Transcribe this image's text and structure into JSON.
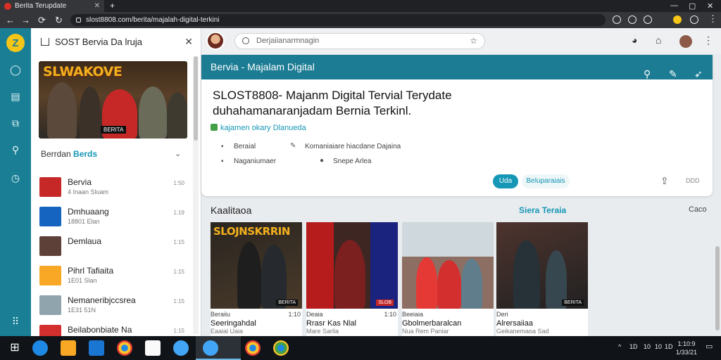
{
  "browser": {
    "tab_title": "Berita Terupdate",
    "new_tab_glyph": "+",
    "url": "slost8808.com/berita/majalah-digital-terkini",
    "window_controls": [
      "—",
      "▢",
      "✕"
    ]
  },
  "rail": {
    "logo_glyph": "Z",
    "icons": [
      "chat-icon",
      "save-icon",
      "book-icon",
      "search-icon",
      "clock-icon",
      "apps-icon"
    ]
  },
  "sidebar": {
    "title": "SOST Bervia Da lruja",
    "hero_title": "SLWAKOVE",
    "hero_caption": "BERITA",
    "section_prefix": "Berrdan",
    "section_accent": "Berds",
    "items": [
      {
        "title": "Bervia",
        "sub": "4 Inaan Sluam",
        "meta": "1:50",
        "color": "#c62828"
      },
      {
        "title": "Dmhuaang",
        "sub": "18801 Elan",
        "meta": "1:19",
        "color": "#1565c0"
      },
      {
        "title": "Demlaua",
        "sub": "",
        "meta": "1:15",
        "color": "#5d4037"
      },
      {
        "title": "Pihrl Tafiaita",
        "sub": "1E01 Slan",
        "meta": "1:15",
        "color": "#f9a825"
      },
      {
        "title": "Nemaneribjccsrea",
        "sub": "1E31 51N",
        "meta": "1:15",
        "color": "#90a4ae"
      },
      {
        "title": "Beilabonbiate Na",
        "sub": "",
        "meta": "1:15",
        "color": "#d32f2f"
      }
    ]
  },
  "main": {
    "search_placeholder": "Derjaiianarmnagin",
    "card_bar_title": "Bervia - Majalam Digital",
    "headline_1": "SLOST8808- Majanm Digital Tervial Terydate",
    "headline_2": "duhahamanaranjadam Bernia Terkinl.",
    "source": "kajamen okary Dlanueda",
    "meta": [
      {
        "icon": "tag-icon",
        "label": "Beraial"
      },
      {
        "icon": "pin-icon",
        "label": "Komaniaiare hiacdane Dajaina"
      },
      {
        "icon": "doc-icon",
        "label": "Naganiumaer"
      },
      {
        "icon": "user-icon",
        "label": "Snepe Arlea"
      }
    ],
    "pill_label": "Uda",
    "secondary_label": "Beluparaiais",
    "more_label": "DDD",
    "grid_title": "Kaalitaoa",
    "grid_link": "Siera Teraia",
    "grid_right": "Caco",
    "tiles": [
      {
        "banner": "SLOJNSKRRIN",
        "tag": "BERITA",
        "cap1": "Beraiiu",
        "cap1r": "1:10",
        "cap2": "Seeringahdal",
        "cap3": "Eaaial Uaia",
        "c1": "#2a2520",
        "c2": "#4a3b2a"
      },
      {
        "banner": "",
        "tag": "SLOB",
        "cap1": "Deaia",
        "cap1r": "1:10",
        "cap2": "Rrasr Kas Nlal",
        "cap3": "Mare Sarila",
        "c1": "#b71c1c",
        "c2": "#3e2723"
      },
      {
        "banner": "",
        "tag": "",
        "cap1": "Beeiaia",
        "cap1r": "",
        "cap2": "Gbolmerbaralcan",
        "cap3": "Nua Rem Paniar",
        "c1": "#8d6e63",
        "c2": "#d32f2f"
      },
      {
        "banner": "",
        "tag": "BERITA",
        "cap1": "Deri",
        "cap1r": "",
        "cap2": "Alrersaiiaa",
        "cap3": "Geikanemaoa Sad",
        "c1": "#4e342e",
        "c2": "#212121"
      }
    ]
  },
  "taskbar": {
    "tray": [
      "^",
      "1D",
      "10",
      "10",
      "1D"
    ],
    "time": "1:10:9",
    "date": "1/33/21"
  }
}
